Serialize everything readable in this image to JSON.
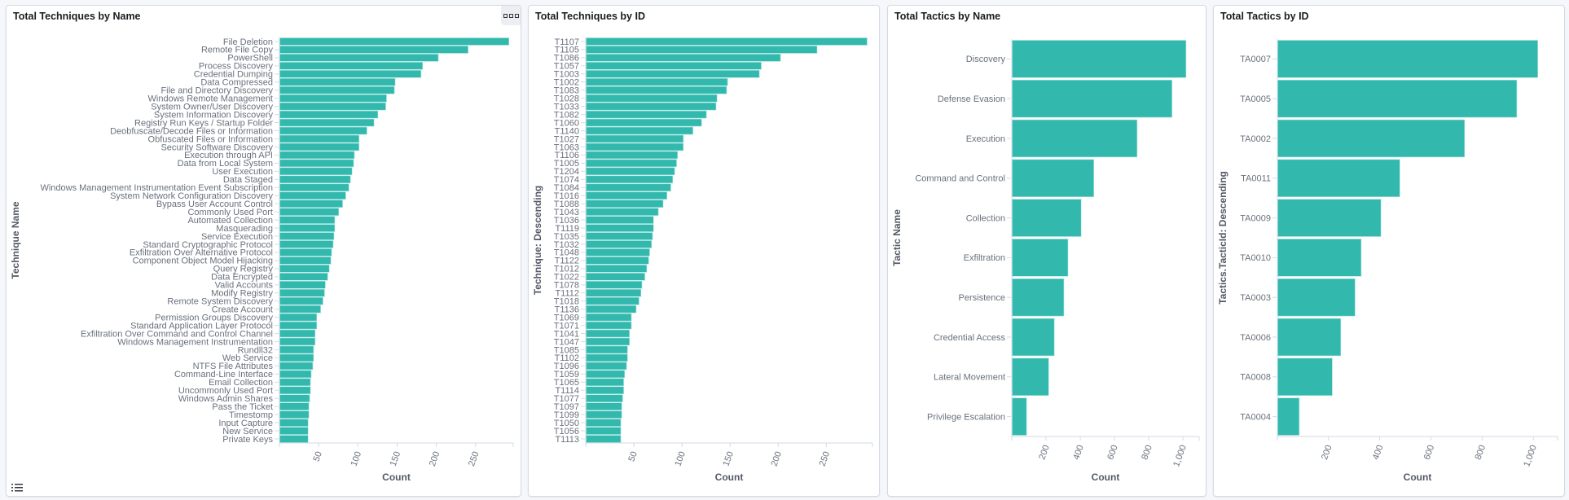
{
  "colors": {
    "bar": "#32b8ad",
    "bar_stroke": "#a8e3de",
    "axis": "#d3dae6",
    "text": "#69707d"
  },
  "panels": [
    {
      "title": "Total Techniques by Name",
      "has_options_button": true,
      "has_legend_toggle": true
    },
    {
      "title": "Total Techniques by ID"
    },
    {
      "title": "Total Tactics by Name"
    },
    {
      "title": "Total Tactics by ID"
    }
  ],
  "icons": {
    "options": "ellipsis-boxes-icon",
    "legend": "list-icon"
  },
  "chart_data": [
    {
      "type": "bar",
      "orientation": "horizontal",
      "title": "Total Techniques by Name",
      "xlabel": "Count",
      "ylabel": "Technique Name",
      "xlim": [
        0,
        298
      ],
      "xticks": [
        50,
        100,
        150,
        200,
        250
      ],
      "categories": [
        "File Deletion",
        "Remote File Copy",
        "PowerShell",
        "Process Discovery",
        "Credential Dumping",
        "Data Compressed",
        "File and Directory Discovery",
        "Windows Remote Management",
        "System Owner/User Discovery",
        "System Information Discovery",
        "Registry Run Keys / Startup Folder",
        "Deobfuscate/Decode Files or Information",
        "Obfuscated Files or Information",
        "Security Software Discovery",
        "Execution through API",
        "Data from Local System",
        "User Execution",
        "Data Staged",
        "Windows Management Instrumentation Event Subscription",
        "System Network Configuration Discovery",
        "Bypass User Account Control",
        "Commonly Used Port",
        "Automated Collection",
        "Masquerading",
        "Service Execution",
        "Standard Cryptographic Protocol",
        "Exfiltration Over Alternative Protocol",
        "Component Object Model Hijacking",
        "Query Registry",
        "Data Encrypted",
        "Valid Accounts",
        "Modify Registry",
        "Remote System Discovery",
        "Create Account",
        "Permission Groups Discovery",
        "Standard Application Layer Protocol",
        "Exfiltration Over Command and Control Channel",
        "Windows Management Instrumentation",
        "Rundll32",
        "Web Service",
        "NTFS File Attributes",
        "Command-Line Interface",
        "Email Collection",
        "Uncommonly Used Port",
        "Windows Admin Shares",
        "Pass the Ticket",
        "Timestomp",
        "Input Capture",
        "New Service",
        "Private Keys"
      ],
      "values": [
        292,
        240,
        202,
        182,
        180,
        147,
        146,
        136,
        135,
        125,
        120,
        111,
        101,
        101,
        95,
        94,
        92,
        90,
        88,
        84,
        80,
        75,
        70,
        70,
        69,
        68,
        66,
        65,
        63,
        61,
        58,
        57,
        55,
        52,
        47,
        47,
        45,
        45,
        43,
        43,
        42,
        40,
        39,
        39,
        38,
        37,
        37,
        36,
        36,
        36
      ]
    },
    {
      "type": "bar",
      "orientation": "horizontal",
      "title": "Total Techniques by ID",
      "xlabel": "Count",
      "ylabel": "Technique: Descending",
      "xlim": [
        0,
        298
      ],
      "xticks": [
        50,
        100,
        150,
        200,
        250
      ],
      "categories": [
        "T1107",
        "T1105",
        "T1086",
        "T1057",
        "T1003",
        "T1002",
        "T1083",
        "T1028",
        "T1033",
        "T1082",
        "T1060",
        "T1140",
        "T1027",
        "T1063",
        "T1106",
        "T1005",
        "T1204",
        "T1074",
        "T1084",
        "T1016",
        "T1088",
        "T1043",
        "T1036",
        "T1119",
        "T1035",
        "T1032",
        "T1048",
        "T1122",
        "T1012",
        "T1022",
        "T1078",
        "T1112",
        "T1018",
        "T1136",
        "T1069",
        "T1071",
        "T1041",
        "T1047",
        "T1085",
        "T1102",
        "T1096",
        "T1059",
        "T1065",
        "T1114",
        "T1077",
        "T1097",
        "T1099",
        "T1050",
        "T1056",
        "T1113"
      ],
      "values": [
        292,
        240,
        202,
        182,
        180,
        147,
        146,
        136,
        135,
        125,
        120,
        111,
        101,
        101,
        95,
        94,
        92,
        90,
        88,
        84,
        80,
        75,
        70,
        70,
        69,
        68,
        66,
        65,
        63,
        61,
        58,
        57,
        55,
        52,
        47,
        47,
        45,
        45,
        43,
        43,
        42,
        40,
        39,
        39,
        38,
        37,
        37,
        36,
        36,
        36
      ]
    },
    {
      "type": "bar",
      "orientation": "horizontal",
      "title": "Total Tactics by Name",
      "xlabel": "Count",
      "ylabel": "Tactic Name",
      "xlim": [
        0,
        1095
      ],
      "xticks": [
        200,
        400,
        600,
        800,
        1000
      ],
      "xtick_labels": [
        "200",
        "400",
        "600",
        "800",
        "1,000"
      ],
      "categories": [
        "Discovery",
        "Defense Evasion",
        "Execution",
        "Command and Control",
        "Collection",
        "Exfiltration",
        "Persistence",
        "Credential Access",
        "Lateral Movement",
        "Privilege Escalation"
      ],
      "values": [
        1016,
        934,
        730,
        477,
        403,
        326,
        302,
        246,
        213,
        84
      ]
    },
    {
      "type": "bar",
      "orientation": "horizontal",
      "title": "Total Tactics by ID",
      "xlabel": "Count",
      "ylabel": "Tactics.TacticId: Descending",
      "xlim": [
        0,
        1095
      ],
      "xticks": [
        200,
        400,
        600,
        800,
        1000
      ],
      "xtick_labels": [
        "200",
        "400",
        "600",
        "800",
        "1,000"
      ],
      "categories": [
        "TA0007",
        "TA0005",
        "TA0002",
        "TA0011",
        "TA0009",
        "TA0010",
        "TA0003",
        "TA0006",
        "TA0008",
        "TA0004"
      ],
      "values": [
        1016,
        934,
        730,
        477,
        403,
        326,
        302,
        246,
        213,
        84
      ]
    }
  ]
}
